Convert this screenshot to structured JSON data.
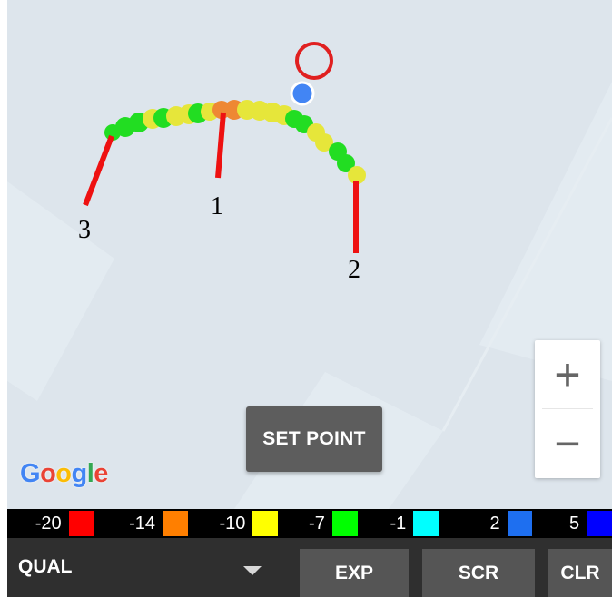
{
  "map": {
    "provider_logo": "Google",
    "annotations": [
      "1",
      "2",
      "3"
    ],
    "location_icon": "my-location-dot-icon",
    "target_icon": "target-circle-icon",
    "zoom_in_label": "+",
    "zoom_out_label": "−",
    "set_point_label": "SET POINT"
  },
  "legend": [
    {
      "label": "-20",
      "color": "#ff0000"
    },
    {
      "label": "-14",
      "color": "#ff7f00"
    },
    {
      "label": "-10",
      "color": "#ffff00"
    },
    {
      "label": "-7",
      "color": "#00ff00"
    },
    {
      "label": "-1",
      "color": "#00ffff"
    },
    {
      "label": "2",
      "color": "#1e6ff0"
    },
    {
      "label": "5",
      "color": "#0000ff"
    }
  ],
  "toolbar": {
    "mode_value": "QUAL",
    "exp_label": "EXP",
    "scr_label": "SCR",
    "clr_label": "CLR"
  },
  "colors": {
    "map_bg": "#dde5ec",
    "toolbar_bg": "#2f2f2f",
    "button_bg": "#555555",
    "marker_red": "#e02020",
    "location_blue": "#4285f4"
  }
}
